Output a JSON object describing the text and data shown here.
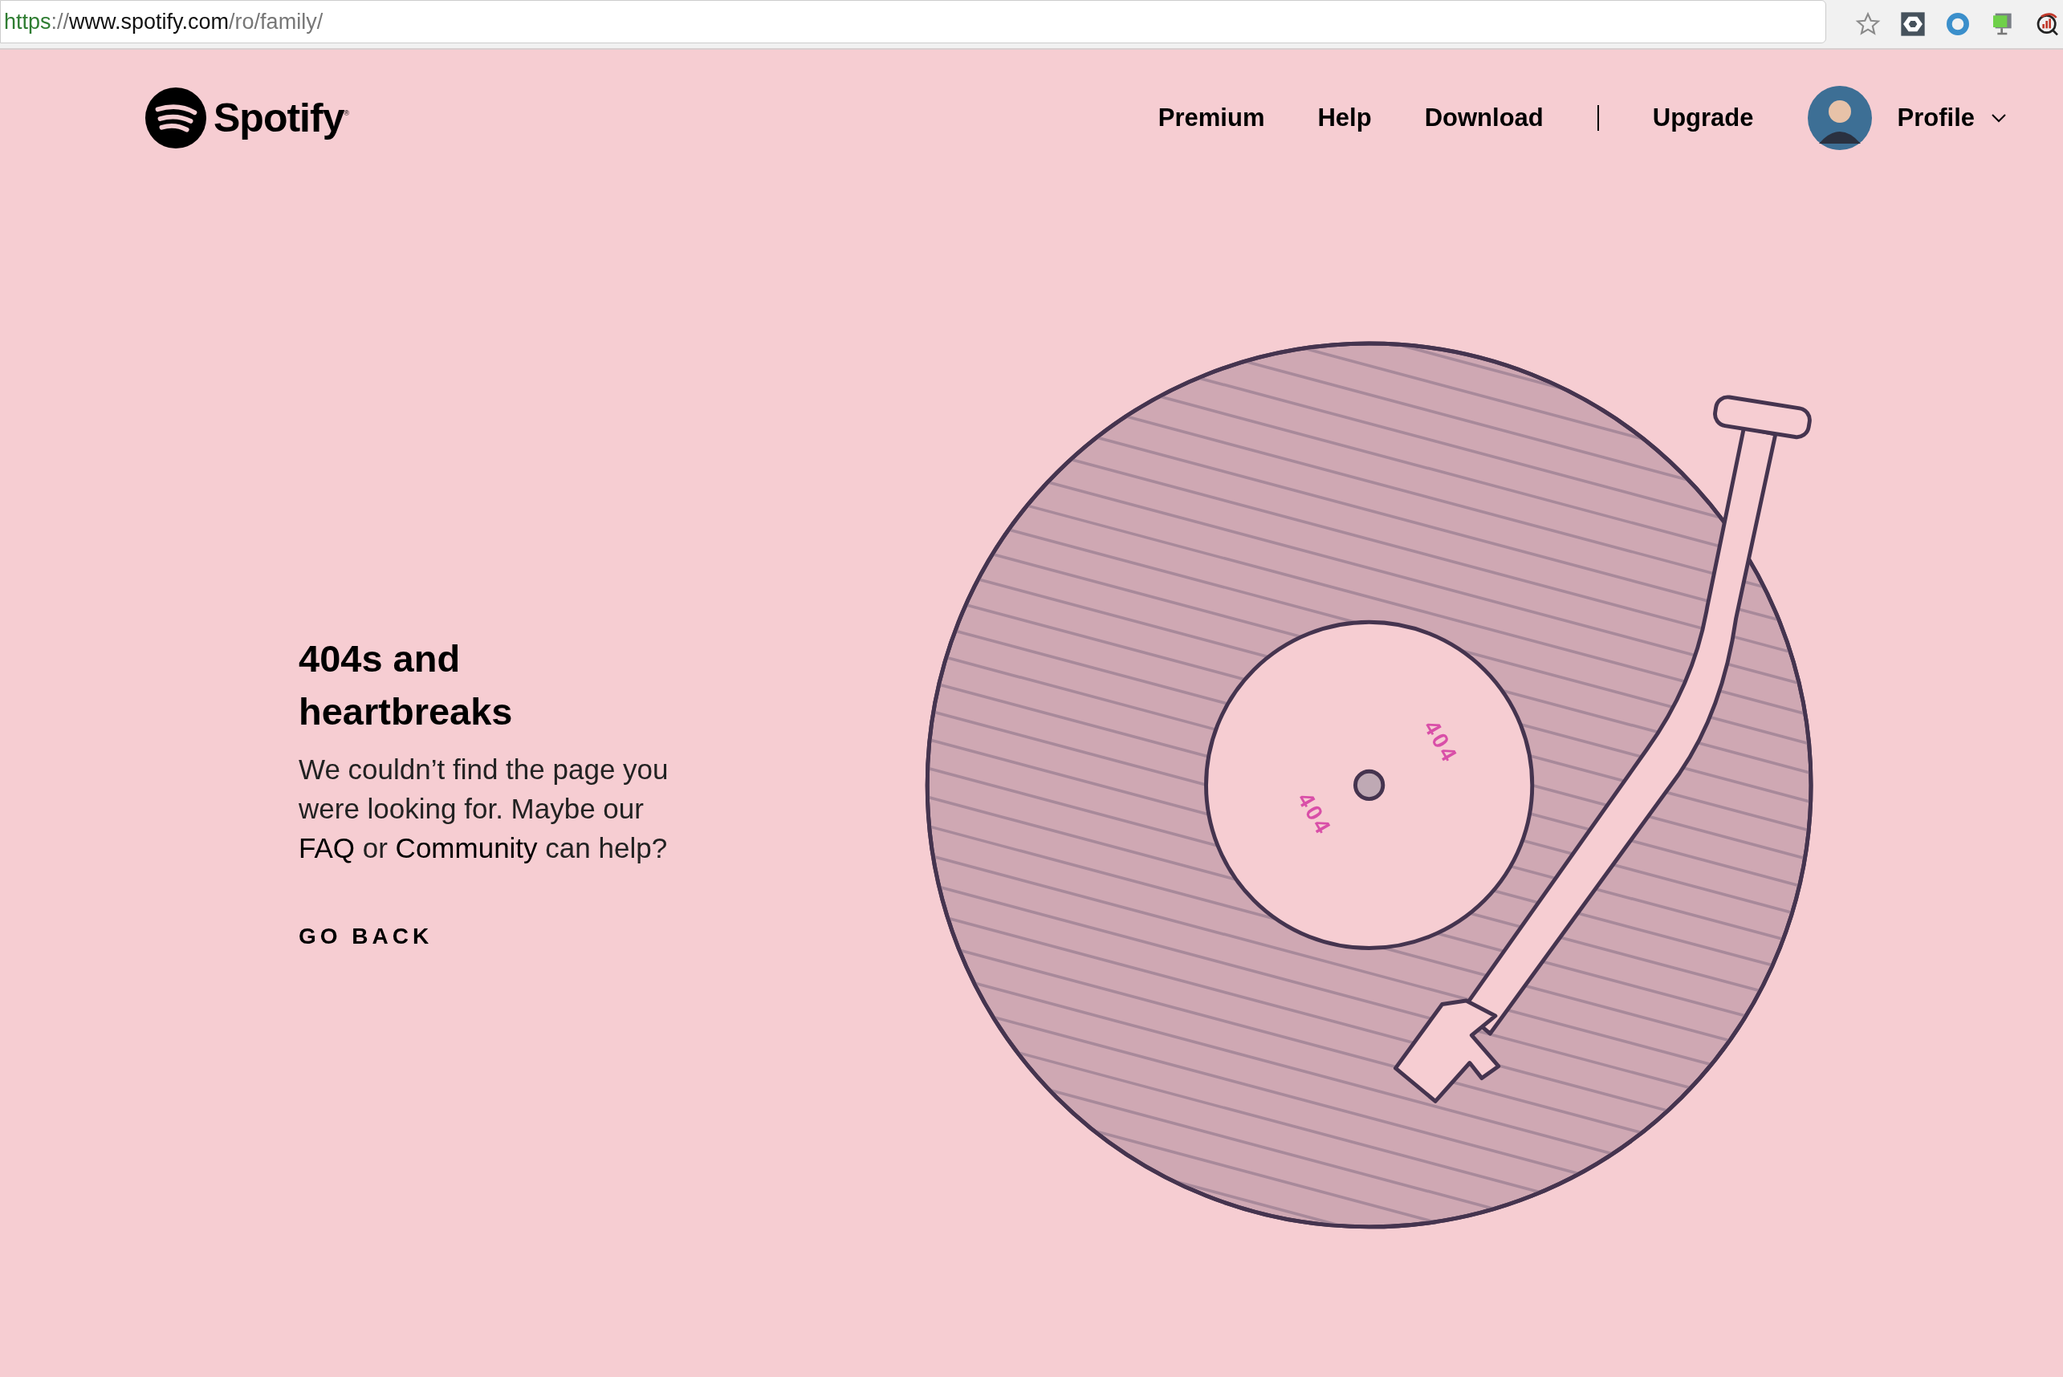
{
  "browser": {
    "url": [
      {
        "kind": "scheme",
        "text": "https"
      },
      {
        "kind": "sep",
        "text": "://"
      },
      {
        "kind": "host",
        "text": "www.spotify.com"
      },
      {
        "kind": "path",
        "text": "/ro/family/"
      }
    ]
  },
  "header": {
    "logo": {
      "text": "Spotify",
      "mark": "®"
    },
    "links": [
      "Premium",
      "Help",
      "Download"
    ],
    "account_links": [
      "Upgrade"
    ],
    "profile": {
      "label": "Profile"
    }
  },
  "content": {
    "heading": "404s and heartbreaks",
    "message": [
      {
        "kind": "text",
        "text": "We couldn’t find the page you were looking for. Maybe our "
      },
      {
        "kind": "link",
        "text": "FAQ"
      },
      {
        "kind": "text",
        "text": " or "
      },
      {
        "kind": "link",
        "text": "Community"
      },
      {
        "kind": "text",
        "text": " can help?"
      }
    ],
    "back_link": "GO BACK"
  },
  "record": {
    "label_texts": [
      "404",
      "404"
    ]
  }
}
